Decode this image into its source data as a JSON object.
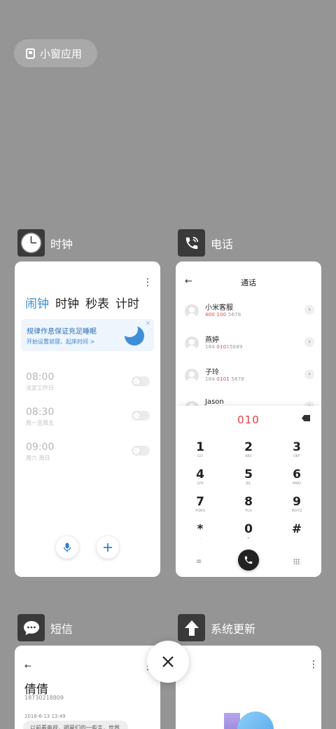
{
  "floating_window": {
    "label": "小窗应用"
  },
  "apps": {
    "clock": {
      "name": "时钟"
    },
    "phone": {
      "name": "电话"
    },
    "messages": {
      "name": "短信"
    },
    "updater": {
      "name": "系统更新"
    }
  },
  "clock": {
    "tabs": [
      "闹钟",
      "时钟",
      "秒表",
      "计时"
    ],
    "active_tab": "闹钟",
    "promo": {
      "title": "规律作息保证充足睡眠",
      "subtitle": "开始设置就寝、起床时间 >"
    },
    "alarms": [
      {
        "time": "08:00",
        "repeat": "法定工作日",
        "enabled": false
      },
      {
        "time": "08:30",
        "repeat": "周一至周五",
        "enabled": false
      },
      {
        "time": "09:00",
        "repeat": "周六 周日",
        "enabled": false
      }
    ]
  },
  "phone": {
    "title": "通话",
    "contacts": [
      {
        "name": "小米客服",
        "num_pre": "",
        "num_hl": "400 100",
        "num_post": " 5678"
      },
      {
        "name": "燕婷",
        "num_pre": "184 ",
        "num_hl": "010",
        "num_post": "15689"
      },
      {
        "name": "子玲",
        "num_pre": "184 ",
        "num_hl": "0101",
        "num_post": " 5678"
      },
      {
        "name": "Jason",
        "num_pre": "",
        "num_hl": "",
        "num_post": ""
      }
    ],
    "dial_input": "010",
    "keys": [
      {
        "d": "1",
        "l": "GO"
      },
      {
        "d": "2",
        "l": "ABC"
      },
      {
        "d": "3",
        "l": "DEF"
      },
      {
        "d": "4",
        "l": "GHI"
      },
      {
        "d": "5",
        "l": "JKL"
      },
      {
        "d": "6",
        "l": "MNO"
      },
      {
        "d": "7",
        "l": "PQRS"
      },
      {
        "d": "8",
        "l": "TUV"
      },
      {
        "d": "9",
        "l": "WXYZ"
      },
      {
        "d": "*",
        "l": ","
      },
      {
        "d": "0",
        "l": "+"
      },
      {
        "d": "#",
        "l": ""
      }
    ]
  },
  "messages": {
    "contact_name": "倩倩",
    "contact_number": "18730218809",
    "timestamp": "2016-6-13 13:49",
    "preview": "以前看电视，明星们的一些言，世界"
  },
  "icons": {
    "clock": "clock-icon",
    "phone": "phone-icon",
    "messages": "chat-bubble-icon",
    "updater": "up-arrow-icon",
    "close": "close-icon",
    "mic": "microphone-icon",
    "add": "plus-icon"
  },
  "colors": {
    "accent_blue": "#3a8fd6",
    "highlight_red": "#e24444",
    "background": "#959595"
  }
}
